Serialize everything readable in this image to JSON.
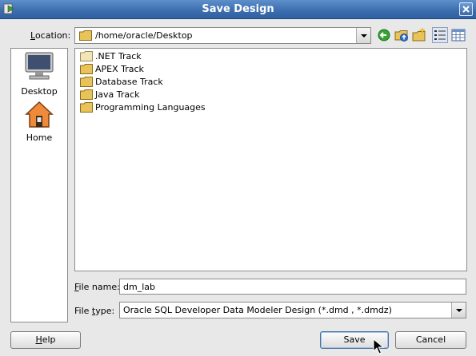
{
  "window": {
    "title": "Save Design"
  },
  "location": {
    "label_mnemonic": "L",
    "label_rest": "ocation:",
    "path": "/home/oracle/Desktop",
    "toolbar_icons": [
      "back-icon",
      "up-folder-icon",
      "new-folder-icon",
      "list-view-icon",
      "details-view-icon"
    ]
  },
  "places": [
    {
      "label": "Desktop",
      "icon": "desktop-icon"
    },
    {
      "label": "Home",
      "icon": "home-icon"
    }
  ],
  "files": [
    {
      "name": ".NET Track",
      "icon": "folder-icon"
    },
    {
      "name": "APEX Track",
      "icon": "folder-icon"
    },
    {
      "name": "Database Track",
      "icon": "folder-icon"
    },
    {
      "name": "Java Track",
      "icon": "folder-icon"
    },
    {
      "name": "Programming Languages",
      "icon": "folder-icon"
    }
  ],
  "file_name": {
    "label_mnemonic": "F",
    "label_rest": "ile name:",
    "value": "dm_lab"
  },
  "file_type": {
    "label_pre": "File ",
    "label_mnemonic": "t",
    "label_rest": "ype:",
    "value": "Oracle SQL Developer Data Modeler Design (*.dmd , *.dmdz)"
  },
  "buttons": {
    "help_mnemonic": "H",
    "help_rest": "elp",
    "save": "Save",
    "cancel": "Cancel"
  },
  "colors": {
    "title_bar": "#3d6fb0",
    "folder": "#e8c35a",
    "dialog_bg": "#e8e8e8"
  }
}
